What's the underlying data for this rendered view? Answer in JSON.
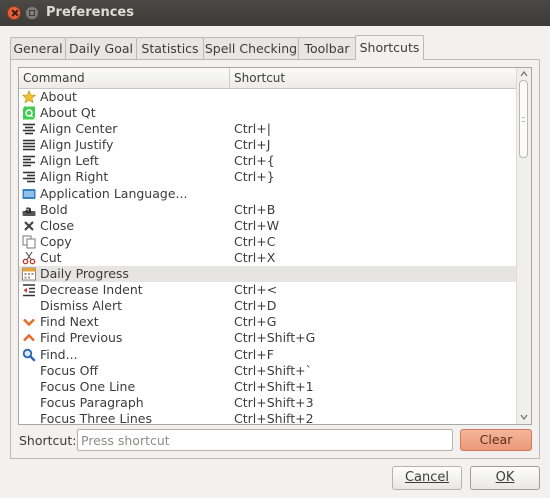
{
  "window": {
    "title": "Preferences"
  },
  "tabs": [
    {
      "label": "General"
    },
    {
      "label": "Daily Goal"
    },
    {
      "label": "Statistics"
    },
    {
      "label": "Spell Checking"
    },
    {
      "label": "Toolbar"
    },
    {
      "label": "Shortcuts",
      "active": true
    }
  ],
  "table": {
    "headers": {
      "command": "Command",
      "shortcut": "Shortcut"
    },
    "rows": [
      {
        "icon": "star-icon",
        "command": "About",
        "shortcut": ""
      },
      {
        "icon": "qt-logo-icon",
        "command": "About Qt",
        "shortcut": ""
      },
      {
        "icon": "align-center-icon",
        "command": "Align Center",
        "shortcut": "Ctrl+|"
      },
      {
        "icon": "align-justify-icon",
        "command": "Align Justify",
        "shortcut": "Ctrl+J"
      },
      {
        "icon": "align-left-icon",
        "command": "Align Left",
        "shortcut": "Ctrl+{"
      },
      {
        "icon": "align-right-icon",
        "command": "Align Right",
        "shortcut": "Ctrl+}"
      },
      {
        "icon": "language-icon",
        "command": "Application Language...",
        "shortcut": ""
      },
      {
        "icon": "bold-icon",
        "command": "Bold",
        "shortcut": "Ctrl+B"
      },
      {
        "icon": "close-icon",
        "command": "Close",
        "shortcut": "Ctrl+W"
      },
      {
        "icon": "copy-icon",
        "command": "Copy",
        "shortcut": "Ctrl+C"
      },
      {
        "icon": "cut-icon",
        "command": "Cut",
        "shortcut": "Ctrl+X"
      },
      {
        "icon": "calendar-icon",
        "command": "Daily Progress",
        "shortcut": "",
        "selected": true
      },
      {
        "icon": "decrease-indent-icon",
        "command": "Decrease Indent",
        "shortcut": "Ctrl+<"
      },
      {
        "icon": "",
        "command": "Dismiss Alert",
        "shortcut": "Ctrl+D"
      },
      {
        "icon": "chevron-down-icon",
        "command": "Find Next",
        "shortcut": "Ctrl+G"
      },
      {
        "icon": "chevron-up-icon",
        "command": "Find Previous",
        "shortcut": "Ctrl+Shift+G"
      },
      {
        "icon": "search-icon",
        "command": "Find...",
        "shortcut": "Ctrl+F"
      },
      {
        "icon": "",
        "command": "Focus Off",
        "shortcut": "Ctrl+Shift+`"
      },
      {
        "icon": "",
        "command": "Focus One Line",
        "shortcut": "Ctrl+Shift+1"
      },
      {
        "icon": "",
        "command": "Focus Paragraph",
        "shortcut": "Ctrl+Shift+3"
      },
      {
        "icon": "",
        "command": "Focus Three Lines",
        "shortcut": "Ctrl+Shift+2"
      }
    ]
  },
  "shortcut_field": {
    "label": "Shortcut:",
    "placeholder": "Press shortcut",
    "value": ""
  },
  "buttons": {
    "clear": "Clear",
    "cancel": "Cancel",
    "ok": "OK"
  },
  "colors": {
    "titlebar": "#3c3b37",
    "close": "#e9613a",
    "clear_button": "#ec9879",
    "selected_row": "#e6e5e3"
  }
}
